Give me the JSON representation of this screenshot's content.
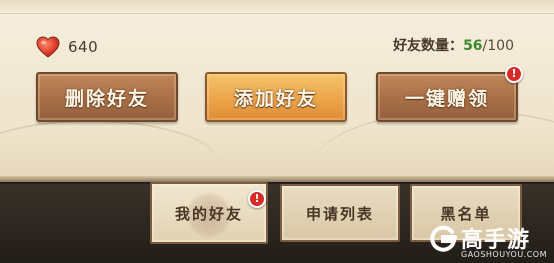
{
  "header": {
    "heart_count": "640",
    "friend_label": "好友数量：",
    "friend_current": "56",
    "friend_max": "/100"
  },
  "actions": {
    "delete_label": "删除好友",
    "add_label": "添加好友",
    "claim_label": "一键赠领",
    "claim_badge": "!"
  },
  "tabs": [
    {
      "label": "我的好友",
      "badge": "!"
    },
    {
      "label": "申请列表"
    },
    {
      "label": "黑名单"
    }
  ],
  "watermark": {
    "brand": "高手游",
    "domain": "GAOSHOUYOU.COM"
  },
  "colors": {
    "accent_green": "#3d8a2e",
    "badge_red": "#d82a26",
    "brown_button": "#a86e46",
    "orange_button": "#eca44a"
  },
  "icons": {
    "heart": "heart-icon",
    "alert": "exclamation-badge-icon",
    "logo": "gaoshouyou-logo-icon"
  }
}
